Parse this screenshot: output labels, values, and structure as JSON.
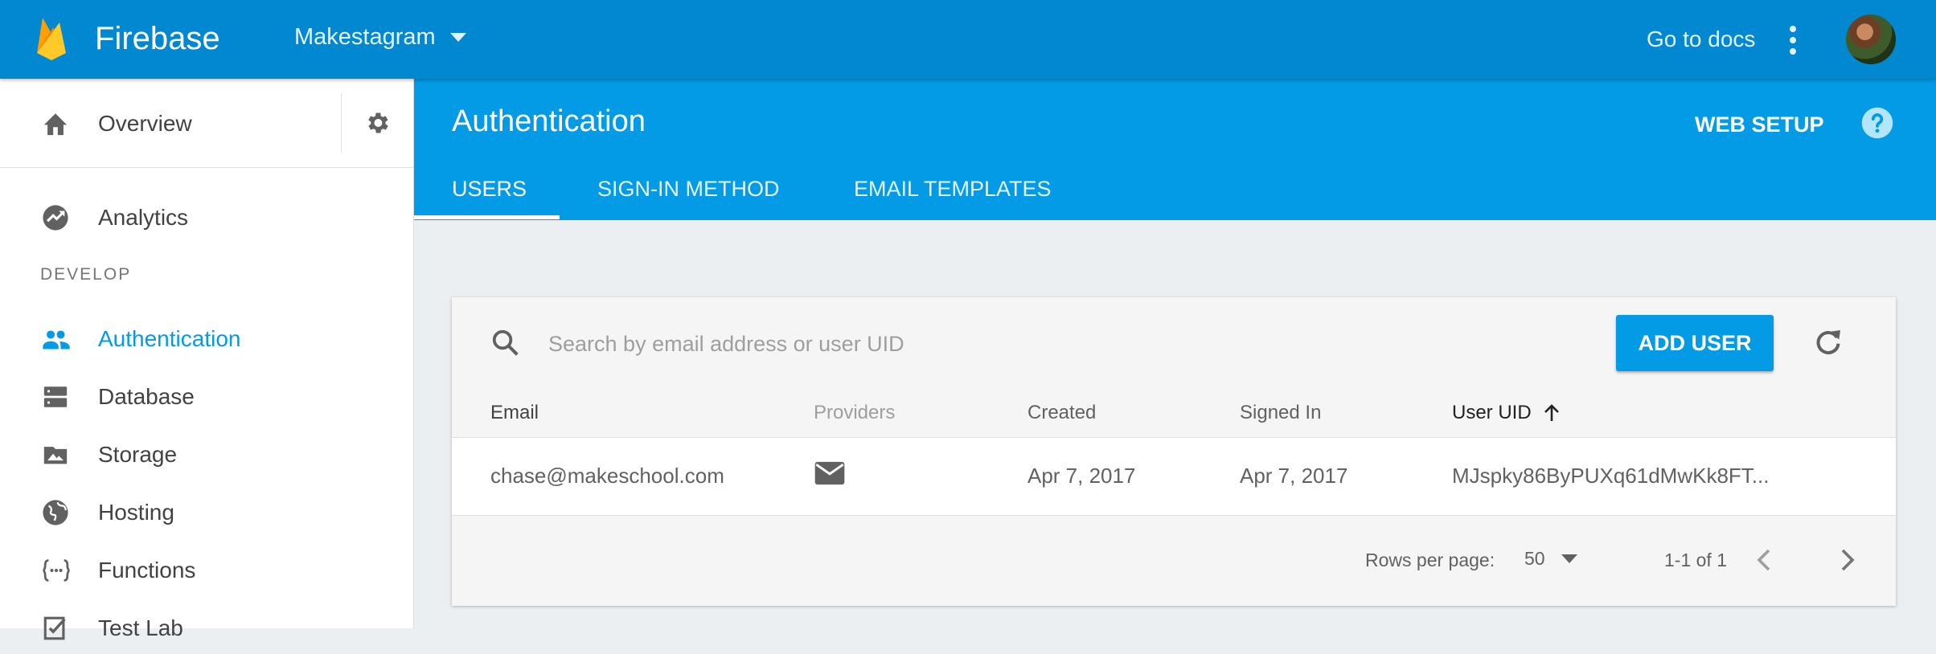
{
  "app": {
    "name": "Firebase",
    "project": "Makestagram"
  },
  "topbar": {
    "docs_link": "Go to docs",
    "more_icon": "more-vert-icon",
    "avatar": "user-avatar"
  },
  "sidebar": {
    "overview": {
      "label": "Overview",
      "icon": "home-icon"
    },
    "settings_icon": "gear-icon",
    "section": "DEVELOP",
    "items": [
      {
        "label": "Analytics",
        "icon": "analytics-icon",
        "active": false
      },
      {
        "label": "Authentication",
        "icon": "people-icon",
        "active": true
      },
      {
        "label": "Database",
        "icon": "database-icon",
        "active": false
      },
      {
        "label": "Storage",
        "icon": "storage-icon",
        "active": false
      },
      {
        "label": "Hosting",
        "icon": "globe-icon",
        "active": false
      },
      {
        "label": "Functions",
        "icon": "functions-icon",
        "active": false
      },
      {
        "label": "Test Lab",
        "icon": "test-lab-icon",
        "active": false
      }
    ]
  },
  "header": {
    "title": "Authentication",
    "web_setup": "WEB SETUP",
    "tabs": [
      {
        "label": "USERS",
        "active": true
      },
      {
        "label": "SIGN-IN METHOD",
        "active": false
      },
      {
        "label": "EMAIL TEMPLATES",
        "active": false
      }
    ]
  },
  "users": {
    "search_placeholder": "Search by email address or user UID",
    "add_user": "ADD USER",
    "columns": [
      "Email",
      "Providers",
      "Created",
      "Signed In",
      "User UID"
    ],
    "sort_column": "User UID",
    "rows": [
      {
        "email": "chase@makeschool.com",
        "provider_icon": "email-icon",
        "created": "Apr 7, 2017",
        "signed_in": "Apr 7, 2017",
        "uid": "MJspky86ByPUXq61dMwKk8FT..."
      }
    ],
    "rows_per_page_label": "Rows per page:",
    "rows_per_page": "50",
    "range": "1-1 of 1"
  },
  "colors": {
    "topbar": "#0288d1",
    "header": "#039be5",
    "accent": "#039be5",
    "logo": "#ffa000"
  }
}
